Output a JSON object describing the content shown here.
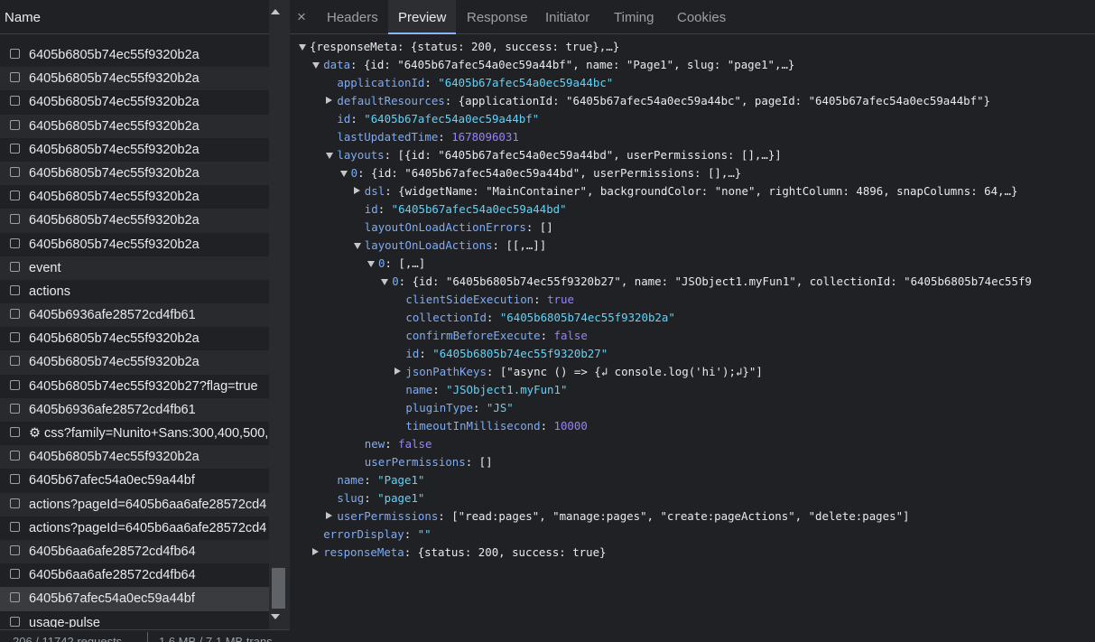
{
  "network_list": {
    "header": "Name",
    "rows": [
      {
        "label": "6405b6805b74ec55f9320b2a",
        "icon": "checkbox"
      },
      {
        "label": "6405b6805b74ec55f9320b2a",
        "icon": "checkbox"
      },
      {
        "label": "6405b6805b74ec55f9320b2a",
        "icon": "checkbox"
      },
      {
        "label": "6405b6805b74ec55f9320b2a",
        "icon": "checkbox"
      },
      {
        "label": "6405b6805b74ec55f9320b2a",
        "icon": "checkbox"
      },
      {
        "label": "6405b6805b74ec55f9320b2a",
        "icon": "checkbox"
      },
      {
        "label": "6405b6805b74ec55f9320b2a",
        "icon": "checkbox"
      },
      {
        "label": "6405b6805b74ec55f9320b2a",
        "icon": "checkbox"
      },
      {
        "label": "6405b6805b74ec55f9320b2a",
        "icon": "checkbox"
      },
      {
        "label": "event",
        "icon": "checkbox"
      },
      {
        "label": "actions",
        "icon": "checkbox"
      },
      {
        "label": "6405b6936afe28572cd4fb61",
        "icon": "checkbox"
      },
      {
        "label": "6405b6805b74ec55f9320b2a",
        "icon": "checkbox"
      },
      {
        "label": "6405b6805b74ec55f9320b2a",
        "icon": "checkbox"
      },
      {
        "label": "6405b6805b74ec55f9320b27?flag=true",
        "icon": "checkbox"
      },
      {
        "label": "6405b6936afe28572cd4fb61",
        "icon": "checkbox"
      },
      {
        "label": "⚙ css?family=Nunito+Sans:300,400,500,",
        "icon": "checkbox"
      },
      {
        "label": "6405b6805b74ec55f9320b2a",
        "icon": "checkbox"
      },
      {
        "label": "6405b67afec54a0ec59a44bf",
        "icon": "checkbox"
      },
      {
        "label": "actions?pageId=6405b6aa6afe28572cd4",
        "icon": "checkbox"
      },
      {
        "label": "actions?pageId=6405b6aa6afe28572cd4",
        "icon": "checkbox"
      },
      {
        "label": "6405b6aa6afe28572cd4fb64",
        "icon": "checkbox"
      },
      {
        "label": "6405b6aa6afe28572cd4fb64",
        "icon": "checkbox"
      },
      {
        "label": "6405b67afec54a0ec59a44bf",
        "icon": "checkbox",
        "selected": true
      },
      {
        "label": "usage-pulse",
        "icon": "checkbox"
      }
    ],
    "status": {
      "requests": "206 / 11742 requests",
      "transferred": "1.6 MB / 7.1 MB trans"
    }
  },
  "tabs": {
    "close": "×",
    "items": [
      "Headers",
      "Preview",
      "Response",
      "Initiator",
      "Timing",
      "Cookies"
    ],
    "active": "Preview"
  },
  "tree": [
    {
      "depth": 0,
      "arrow": "down",
      "parts": [
        [
          "p",
          "{responseMeta: {status: 200, success: true},…}"
        ]
      ]
    },
    {
      "depth": 1,
      "arrow": "down",
      "parts": [
        [
          "k",
          "data"
        ],
        [
          "p",
          ": {id: \"6405b67afec54a0ec59a44bf\", name: \"Page1\", slug: \"page1\",…}"
        ]
      ]
    },
    {
      "depth": 2,
      "arrow": "",
      "parts": [
        [
          "k",
          "applicationId"
        ],
        [
          "p",
          ": "
        ],
        [
          "s",
          "\"6405b67afec54a0ec59a44bc\""
        ]
      ]
    },
    {
      "depth": 2,
      "arrow": "right",
      "parts": [
        [
          "k",
          "defaultResources"
        ],
        [
          "p",
          ": {applicationId: \"6405b67afec54a0ec59a44bc\", pageId: \"6405b67afec54a0ec59a44bf\"}"
        ]
      ]
    },
    {
      "depth": 2,
      "arrow": "",
      "parts": [
        [
          "k",
          "id"
        ],
        [
          "p",
          ": "
        ],
        [
          "s",
          "\"6405b67afec54a0ec59a44bf\""
        ]
      ]
    },
    {
      "depth": 2,
      "arrow": "",
      "parts": [
        [
          "k",
          "lastUpdatedTime"
        ],
        [
          "p",
          ": "
        ],
        [
          "n",
          "1678096031"
        ]
      ]
    },
    {
      "depth": 2,
      "arrow": "down",
      "parts": [
        [
          "k",
          "layouts"
        ],
        [
          "p",
          ": [{id: \"6405b67afec54a0ec59a44bd\", userPermissions: [],…}]"
        ]
      ]
    },
    {
      "depth": 3,
      "arrow": "down",
      "parts": [
        [
          "k",
          "0"
        ],
        [
          "p",
          ": {id: \"6405b67afec54a0ec59a44bd\", userPermissions: [],…}"
        ]
      ]
    },
    {
      "depth": 4,
      "arrow": "right",
      "parts": [
        [
          "k",
          "dsl"
        ],
        [
          "p",
          ": {widgetName: \"MainContainer\", backgroundColor: \"none\", rightColumn: 4896, snapColumns: 64,…}"
        ]
      ]
    },
    {
      "depth": 4,
      "arrow": "",
      "parts": [
        [
          "k",
          "id"
        ],
        [
          "p",
          ": "
        ],
        [
          "s",
          "\"6405b67afec54a0ec59a44bd\""
        ]
      ]
    },
    {
      "depth": 4,
      "arrow": "",
      "parts": [
        [
          "k",
          "layoutOnLoadActionErrors"
        ],
        [
          "p",
          ": []"
        ]
      ]
    },
    {
      "depth": 4,
      "arrow": "down",
      "parts": [
        [
          "k",
          "layoutOnLoadActions"
        ],
        [
          "p",
          ": [[,…]]"
        ]
      ]
    },
    {
      "depth": 5,
      "arrow": "down",
      "parts": [
        [
          "k",
          "0"
        ],
        [
          "p",
          ": [,…]"
        ]
      ]
    },
    {
      "depth": 6,
      "arrow": "down",
      "parts": [
        [
          "k",
          "0"
        ],
        [
          "p",
          ": {id: \"6405b6805b74ec55f9320b27\", name: \"JSObject1.myFun1\", collectionId: \"6405b6805b74ec55f9"
        ]
      ]
    },
    {
      "depth": 7,
      "arrow": "",
      "parts": [
        [
          "k",
          "clientSideExecution"
        ],
        [
          "p",
          ": "
        ],
        [
          "b",
          "true"
        ]
      ]
    },
    {
      "depth": 7,
      "arrow": "",
      "parts": [
        [
          "k",
          "collectionId"
        ],
        [
          "p",
          ": "
        ],
        [
          "s",
          "\"6405b6805b74ec55f9320b2a\""
        ]
      ]
    },
    {
      "depth": 7,
      "arrow": "",
      "parts": [
        [
          "k",
          "confirmBeforeExecute"
        ],
        [
          "p",
          ": "
        ],
        [
          "b",
          "false"
        ]
      ]
    },
    {
      "depth": 7,
      "arrow": "",
      "parts": [
        [
          "k",
          "id"
        ],
        [
          "p",
          ": "
        ],
        [
          "s",
          "\"6405b6805b74ec55f9320b27\""
        ]
      ]
    },
    {
      "depth": 7,
      "arrow": "right",
      "parts": [
        [
          "k",
          "jsonPathKeys"
        ],
        [
          "p",
          ": [\"async () => {↲ console.log('hi');↲}\"]"
        ]
      ]
    },
    {
      "depth": 7,
      "arrow": "",
      "parts": [
        [
          "k",
          "name"
        ],
        [
          "p",
          ": "
        ],
        [
          "s",
          "\"JSObject1.myFun1\""
        ]
      ]
    },
    {
      "depth": 7,
      "arrow": "",
      "parts": [
        [
          "k",
          "pluginType"
        ],
        [
          "p",
          ": "
        ],
        [
          "s",
          "\"JS\""
        ]
      ]
    },
    {
      "depth": 7,
      "arrow": "",
      "parts": [
        [
          "k",
          "timeoutInMillisecond"
        ],
        [
          "p",
          ": "
        ],
        [
          "n",
          "10000"
        ]
      ]
    },
    {
      "depth": 4,
      "arrow": "",
      "parts": [
        [
          "k",
          "new"
        ],
        [
          "p",
          ": "
        ],
        [
          "b",
          "false"
        ]
      ]
    },
    {
      "depth": 4,
      "arrow": "",
      "parts": [
        [
          "k",
          "userPermissions"
        ],
        [
          "p",
          ": []"
        ]
      ]
    },
    {
      "depth": 2,
      "arrow": "",
      "parts": [
        [
          "k",
          "name"
        ],
        [
          "p",
          ": "
        ],
        [
          "s",
          "\"Page1\""
        ]
      ]
    },
    {
      "depth": 2,
      "arrow": "",
      "parts": [
        [
          "k",
          "slug"
        ],
        [
          "p",
          ": "
        ],
        [
          "s",
          "\"page1\""
        ]
      ]
    },
    {
      "depth": 2,
      "arrow": "right",
      "parts": [
        [
          "k",
          "userPermissions"
        ],
        [
          "p",
          ": [\"read:pages\", \"manage:pages\", \"create:pageActions\", \"delete:pages\"]"
        ]
      ]
    },
    {
      "depth": 1,
      "arrow": "",
      "parts": [
        [
          "k",
          "errorDisplay"
        ],
        [
          "p",
          ": "
        ],
        [
          "s",
          "\"\""
        ]
      ]
    },
    {
      "depth": 1,
      "arrow": "right",
      "parts": [
        [
          "k",
          "responseMeta"
        ],
        [
          "p",
          ": {status: 200, success: true}"
        ]
      ]
    }
  ]
}
